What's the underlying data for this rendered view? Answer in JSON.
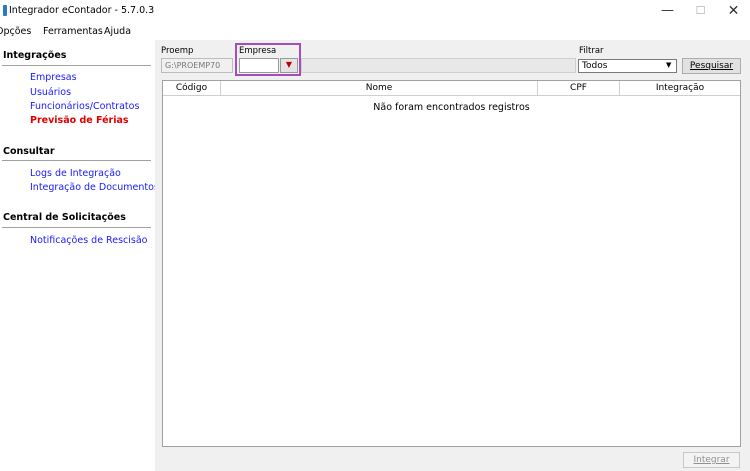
{
  "window": {
    "title": "Integrador eContador - 5.7.0.3",
    "minimize_glyph": "—",
    "maximize_glyph": "☐",
    "close_glyph": "✕"
  },
  "menu": {
    "opcoes": "Opções",
    "ferramentas": "Ferramentas",
    "ajuda": "Ajuda"
  },
  "sidebar": {
    "integracoes": {
      "title": "Integrações",
      "items": [
        "Empresas",
        "Usuários",
        "Funcionários/Contratos",
        "Previsão de Férias"
      ]
    },
    "consultar": {
      "title": "Consultar",
      "items": [
        "Logs de Integração",
        "Integração de Documentos"
      ]
    },
    "solicitacoes": {
      "title": "Central de Solicitações",
      "items": [
        "Notificações de Rescisão"
      ]
    },
    "link_color": "#1a1aff",
    "active_color": "#e00000"
  },
  "form": {
    "proemp_label": "Proemp",
    "proemp_value": "G:\\PROEMP70",
    "empresa_label": "Empresa",
    "empresa_value": "",
    "filtrar_label": "Filtrar",
    "filtrar_value": "Todos",
    "pesquisar_label": "Pesquisar",
    "highlight_color": "#a64cbc"
  },
  "grid": {
    "columns": [
      "Código",
      "Nome",
      "CPF",
      "Integração"
    ],
    "empty_message": "Não foram encontrados registros"
  },
  "footer": {
    "integrar_label": "Integrar"
  }
}
